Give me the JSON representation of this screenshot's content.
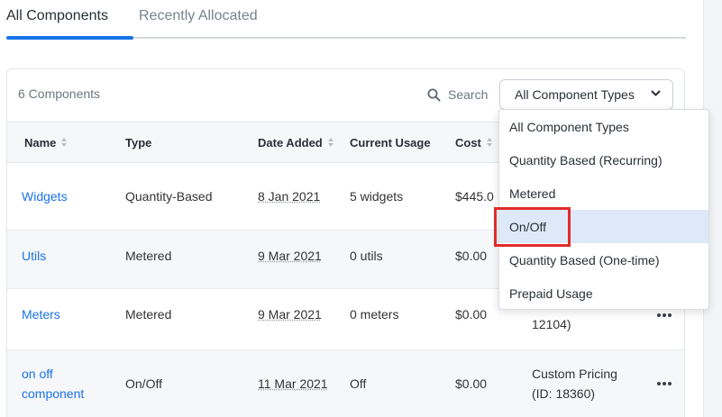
{
  "tabs": [
    {
      "label": "All Components"
    },
    {
      "label": "Recently Allocated"
    }
  ],
  "toolbar": {
    "count_label": "6 Components",
    "search_label": "Search",
    "type_filter_value": "All Component Types"
  },
  "table": {
    "columns": [
      "Name",
      "Type",
      "Date Added",
      "Current Usage",
      "Cost"
    ],
    "rows": [
      {
        "name": "Widgets",
        "type": "Quantity-Based",
        "date_added": "8 Jan 2021",
        "usage": "5 widgets",
        "cost": "$445.0"
      },
      {
        "name": "Utils",
        "type": "Metered",
        "date_added": "9 Mar 2021",
        "usage": "0 utils",
        "cost": "$0.00"
      },
      {
        "name": "Meters",
        "type": "Metered",
        "date_added": "9 Mar 2021",
        "usage": "0 meters",
        "cost": "$0.00",
        "pricing_tail": "12104)"
      },
      {
        "name_line1": "on off",
        "name_line2": "component",
        "type": "On/Off",
        "date_added": "11 Mar 2021",
        "usage": "Off",
        "cost": "$0.00",
        "pricing_line1": "Custom Pricing",
        "pricing_line2": "(ID: 18360)"
      }
    ]
  },
  "dropdown": {
    "options": [
      "All Component Types",
      "Quantity Based (Recurring)",
      "Metered",
      "On/Off",
      "Quantity Based (One-time)",
      "Prepaid Usage"
    ],
    "highlighted": "On/Off"
  },
  "colors": {
    "accent": "#1a73e8",
    "highlight_row": "#dde9f8",
    "focus_outline": "#e02b2b"
  }
}
